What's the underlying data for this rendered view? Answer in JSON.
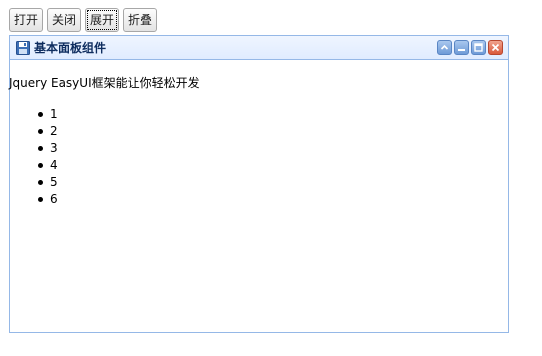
{
  "toolbar": {
    "open_label": "打开",
    "close_label": "关闭",
    "expand_label": "展开",
    "collapse_label": "折叠"
  },
  "panel": {
    "title": "基本面板组件",
    "title_icon": "save-icon",
    "tools": [
      "collapse-tool",
      "minimize-tool",
      "maximize-tool",
      "close-tool"
    ],
    "intro_text": "Jquery EasyUI框架能让你轻松开发",
    "items": [
      "1",
      "2",
      "3",
      "4",
      "5",
      "6"
    ]
  },
  "colors": {
    "panel_border": "#95b8e7",
    "header_bg": "#e0ecff",
    "title_text": "#0e2d5f",
    "close_tool": "#d9593b"
  }
}
